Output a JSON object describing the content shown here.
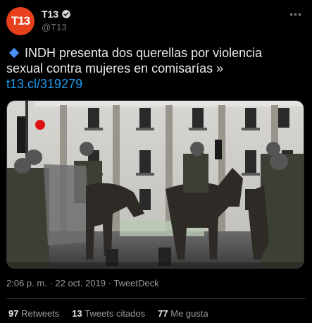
{
  "account": {
    "avatar_text": "T13",
    "name": "T13",
    "handle": "@T13"
  },
  "tweet": {
    "text": "INDH presenta dos querellas por violencia sexual contra mujeres en comisarías »",
    "link": "t13.cl/319279"
  },
  "meta": {
    "time": "2:06 p. m.",
    "date": "22 oct. 2019",
    "source": "TweetDeck",
    "separator": "·"
  },
  "stats": {
    "retweets_count": "97",
    "retweets_label": "Retweets",
    "quotes_count": "13",
    "quotes_label": "Tweets citados",
    "likes_count": "77",
    "likes_label": "Me gusta"
  },
  "icons": {
    "more": "more-options-icon",
    "verified": "verified-badge-icon",
    "diamond": "blue-diamond-icon"
  },
  "colors": {
    "background": "#000000",
    "avatar": "#e8401c",
    "link": "#1d9bf0",
    "verified_badge": "#d9d9d9"
  }
}
